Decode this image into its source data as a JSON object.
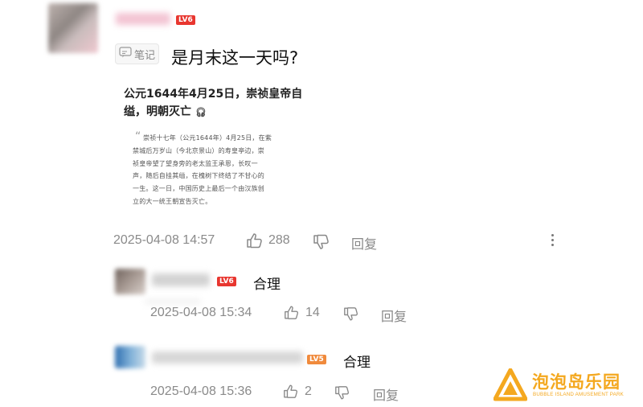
{
  "comment": {
    "level": "LV6",
    "note_tag": "笔记",
    "text": "是月末这一天吗?",
    "article": {
      "title_line1": "公元1644年4月25日，崇祯皇帝自",
      "title_line2": "缢，明朝灭亡",
      "quote_mark": "“",
      "body_lines": [
        "崇祯十七年（公元1644年）4月25日，在紫",
        "禁城后万岁山（今北京景山）的寿皇亭边，崇",
        "祯皇帝望了望身旁的老太监王承恩，长叹一",
        "声，随后自挂其缢，在槐树下终结了不甘心的",
        "一生。这一日，中国历史上最后一个由汉族创",
        "立的大一统王朝宣告灭亡。"
      ]
    },
    "timestamp": "2025-04-08 14:57",
    "likes": "288",
    "reply_label": "回复"
  },
  "replies": [
    {
      "level": "LV6",
      "text": "合理",
      "timestamp": "2025-04-08 15:34",
      "likes": "14",
      "reply_label": "回复"
    },
    {
      "level": "LV5",
      "text": "合理",
      "timestamp": "2025-04-08 15:36",
      "likes": "2",
      "reply_label": "回复"
    }
  ],
  "watermark": {
    "name": "泡泡岛乐园",
    "subtitle": "BUBBLE ISLAND AMUSEMENT PARK"
  },
  "colors": {
    "lv6": "#e8362f",
    "lv5": "#f08a3c",
    "meta_gray": "#8a8a8a",
    "watermark_orange": "#f4a81f"
  }
}
